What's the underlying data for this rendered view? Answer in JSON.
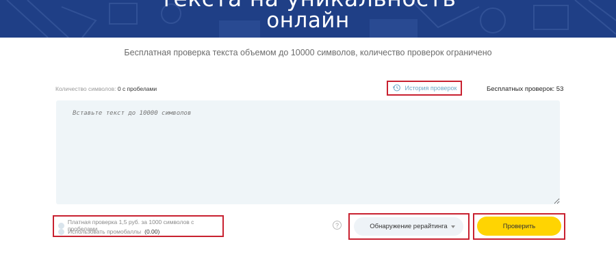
{
  "hero": {
    "title_line1": "текста на уникальность",
    "title_line2": "онлайн"
  },
  "subtitle": "Бесплатная проверка текста объемом до 10000 символов, количество проверок ограничено",
  "counter": {
    "label": "Количество символов:",
    "value": "0 с пробелами"
  },
  "history": {
    "label": "История проверок",
    "icon": "history-clock-icon"
  },
  "free_checks": "Бесплатных проверок: 53",
  "editor": {
    "placeholder": "Вставьте текст до 10000 символов"
  },
  "options": {
    "paid_check": "Платная проверка 1,5 руб. за 1000 символов с пробелами",
    "promo_label": "Использовать промобаллы",
    "promo_value": "(0.00)"
  },
  "help_icon": "?",
  "mode_select": {
    "value": "Обнаружение рерайтинга"
  },
  "check_button": "Проверить",
  "colors": {
    "hero_blue": "#1f3f86",
    "button_yellow": "#ffd402",
    "highlight_red": "#c8202f",
    "editor_bg": "#eff5f8"
  }
}
